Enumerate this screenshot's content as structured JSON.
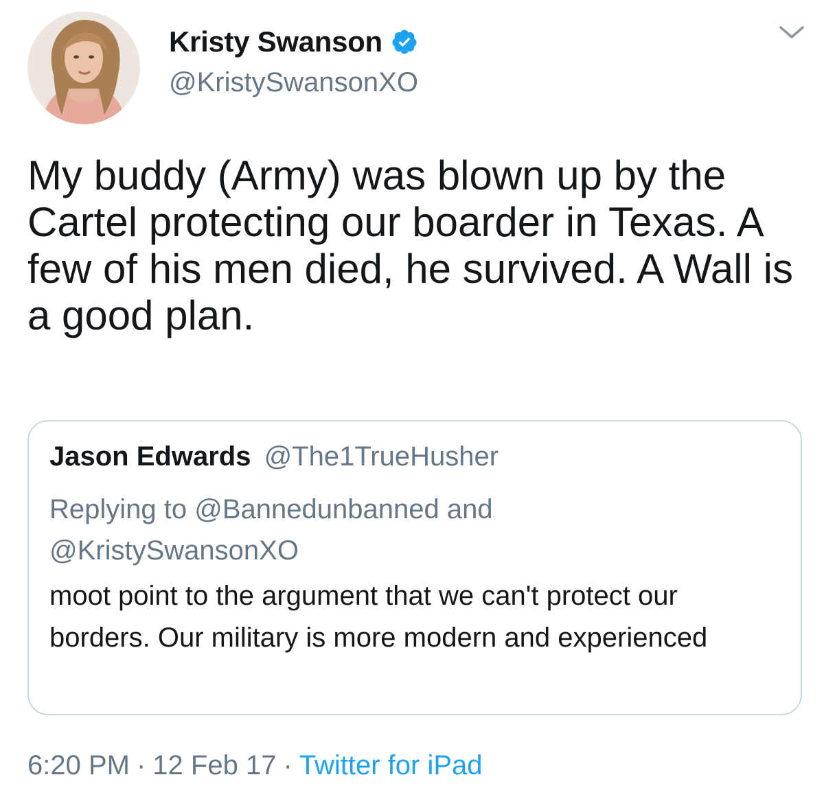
{
  "author": {
    "display_name": "Kristy Swanson",
    "handle": "@KristySwansonXO",
    "verified": true,
    "avatar_icon": "profile-photo",
    "verified_icon": "verified-badge-icon"
  },
  "menu": {
    "icon": "chevron-down-icon"
  },
  "tweet": {
    "text": "My buddy (Army) was blown up by the Cartel protecting our boarder in Texas. A few of his men died, he survived. A Wall is a good plan."
  },
  "quoted_tweet": {
    "display_name": "Jason Edwards",
    "handle": "@The1TrueHusher",
    "reply_prefix": "Replying to",
    "reply_to_1": "@Bannedunbanned",
    "reply_joiner": "and",
    "reply_to_2": "@KristySwansonXO",
    "text": "moot point to the argument that we can't protect our borders.  Our military is more modern and experienced"
  },
  "meta": {
    "time": "6:20 PM",
    "separator": "·",
    "date": "12 Feb 17",
    "source": "Twitter for iPad"
  },
  "colors": {
    "text_primary": "#14171a",
    "text_secondary": "#657786",
    "accent_blue": "#1da1f2",
    "border": "#ccd6dd"
  }
}
